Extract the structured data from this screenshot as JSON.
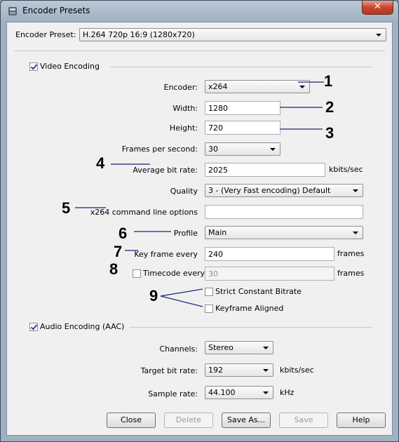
{
  "window": {
    "title": "Encoder Presets",
    "close_glyph": "✕"
  },
  "preset": {
    "label": "Encoder Preset:",
    "value": "H.264 720p 16:9 (1280x720)"
  },
  "video": {
    "checkbox_label": "Video Encoding",
    "encoder": {
      "label": "Encoder:",
      "value": "x264"
    },
    "width": {
      "label": "Width:",
      "value": "1280"
    },
    "height": {
      "label": "Height:",
      "value": "720"
    },
    "fps": {
      "label": "Frames per second:",
      "value": "30"
    },
    "bitrate": {
      "label": "Average bit rate:",
      "value": "2025",
      "unit": "kbits/sec"
    },
    "quality": {
      "label": "Quality",
      "value": "3 - (Very Fast encoding) Default"
    },
    "cmdline": {
      "label": "x264 command line options",
      "value": ""
    },
    "profile": {
      "label": "Profile",
      "value": "Main"
    },
    "keyframe": {
      "label": "Key frame every",
      "value": "240",
      "unit": "frames"
    },
    "timecode": {
      "label": "Timecode every",
      "value": "30",
      "unit": "frames",
      "checked": false
    },
    "strict_cbr": {
      "label": "Strict Constant Bitrate",
      "checked": false
    },
    "keyframe_aligned": {
      "label": "Keyframe Aligned",
      "checked": false
    }
  },
  "audio": {
    "checkbox_label": "Audio Encoding (AAC)",
    "channels": {
      "label": "Channels:",
      "value": "Stereo"
    },
    "bitrate": {
      "label": "Target bit rate:",
      "value": "192",
      "unit": "kbits/sec"
    },
    "samplerate": {
      "label": "Sample rate:",
      "value": "44.100",
      "unit": "kHz"
    }
  },
  "buttons": {
    "close": "Close",
    "delete": "Delete",
    "save_as": "Save As...",
    "save": "Save",
    "help": "Help"
  },
  "annotations": [
    "1",
    "2",
    "3",
    "4",
    "5",
    "6",
    "7",
    "8",
    "9"
  ],
  "icons": {
    "title": "app-icon",
    "close": "close-icon"
  }
}
